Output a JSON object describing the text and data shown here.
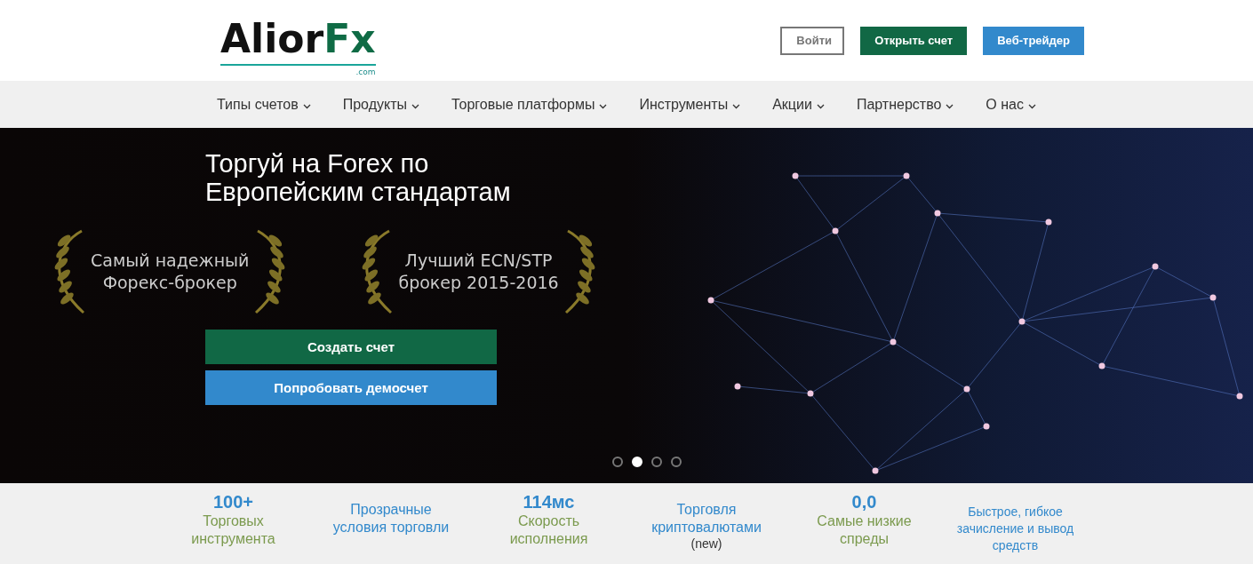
{
  "header": {
    "logo": {
      "text": "Alior",
      "accent": "Fx",
      "domain": ".com"
    },
    "buttons": [
      {
        "label": "Войти",
        "kind": "outline"
      },
      {
        "label": "Открыть счет",
        "kind": "green"
      },
      {
        "label": "Веб-трейдер",
        "kind": "blue"
      }
    ]
  },
  "nav": [
    {
      "label": "Типы счетов"
    },
    {
      "label": "Продукты"
    },
    {
      "label": "Торговые платформы"
    },
    {
      "label": "Инструменты"
    },
    {
      "label": "Акции"
    },
    {
      "label": "Партнерство"
    },
    {
      "label": "О нас"
    }
  ],
  "hero": {
    "title": "Торгуй на Forex по Европейским стандартам",
    "awards": [
      {
        "line_1": "Самый надежный",
        "line_2": "Форекс-брокер"
      },
      {
        "line_1": "Лучший ECN/STP",
        "line_2": "брокер 2015-2016"
      }
    ],
    "buttons": [
      {
        "label": "Создать счет",
        "kind": "green"
      },
      {
        "label": "Попробовать демосчет",
        "kind": "blue"
      }
    ],
    "dots": [
      {
        "selected": false
      },
      {
        "selected": true
      },
      {
        "selected": false
      },
      {
        "selected": false
      }
    ]
  },
  "features": [
    {
      "kind": "stat",
      "value": "100+",
      "label": "Торговых инструмента"
    },
    {
      "kind": "text",
      "label": "Прозрачные условия торговли"
    },
    {
      "kind": "stat",
      "value": "114мс",
      "label": "Скорость исполнения"
    },
    {
      "kind": "text",
      "label": "Торговля криптовалютами",
      "note": "(new)"
    },
    {
      "kind": "stat",
      "value": "0,0",
      "label": "Самые низкие спреды"
    },
    {
      "kind": "small",
      "label": "Быстрое, гибкое зачисление и вывод средств"
    }
  ]
}
